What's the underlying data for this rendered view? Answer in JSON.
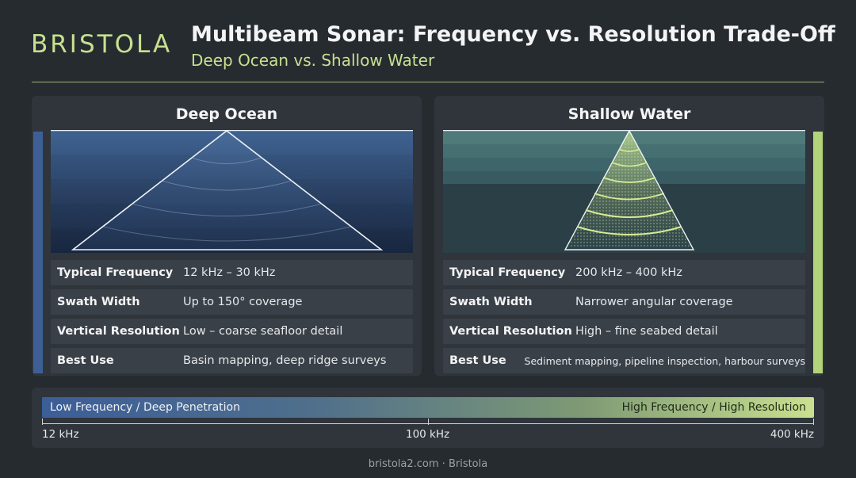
{
  "brand": {
    "logo": "BRISTOLA"
  },
  "header": {
    "title": "Multibeam Sonar: Frequency vs. Resolution Trade-Off",
    "subtitle": "Deep Ocean vs. Shallow Water"
  },
  "colors": {
    "accent_green": "#c8e08f",
    "accent_blue": "#3e5f95",
    "background": "#262b30",
    "panel": "#2f353b"
  },
  "panels": [
    {
      "title": "Deep Ocean",
      "rows": [
        {
          "key": "Typical Frequency",
          "value": "12 kHz – 30 kHz"
        },
        {
          "key": "Swath Width",
          "value": "Up to 150° coverage"
        },
        {
          "key": "Vertical Resolution",
          "value": "Low – coarse seafloor detail"
        },
        {
          "key": "Best Use",
          "value": "Basin mapping, deep ridge surveys"
        }
      ]
    },
    {
      "title": "Shallow Water",
      "rows": [
        {
          "key": "Typical Frequency",
          "value": "200 kHz – 400 kHz"
        },
        {
          "key": "Swath Width",
          "value": "Narrower angular coverage"
        },
        {
          "key": "Vertical Resolution",
          "value": "High – fine seabed detail"
        },
        {
          "key": "Best Use",
          "value": "Sediment mapping, pipeline inspection, harbour surveys"
        }
      ]
    }
  ],
  "scale": {
    "low_label": "Low Frequency / Deep Penetration",
    "high_label": "High Frequency / High Resolution",
    "ticks": [
      "12 kHz",
      "100 kHz",
      "400 kHz"
    ]
  },
  "footer": "bristola2.com · Bristola"
}
